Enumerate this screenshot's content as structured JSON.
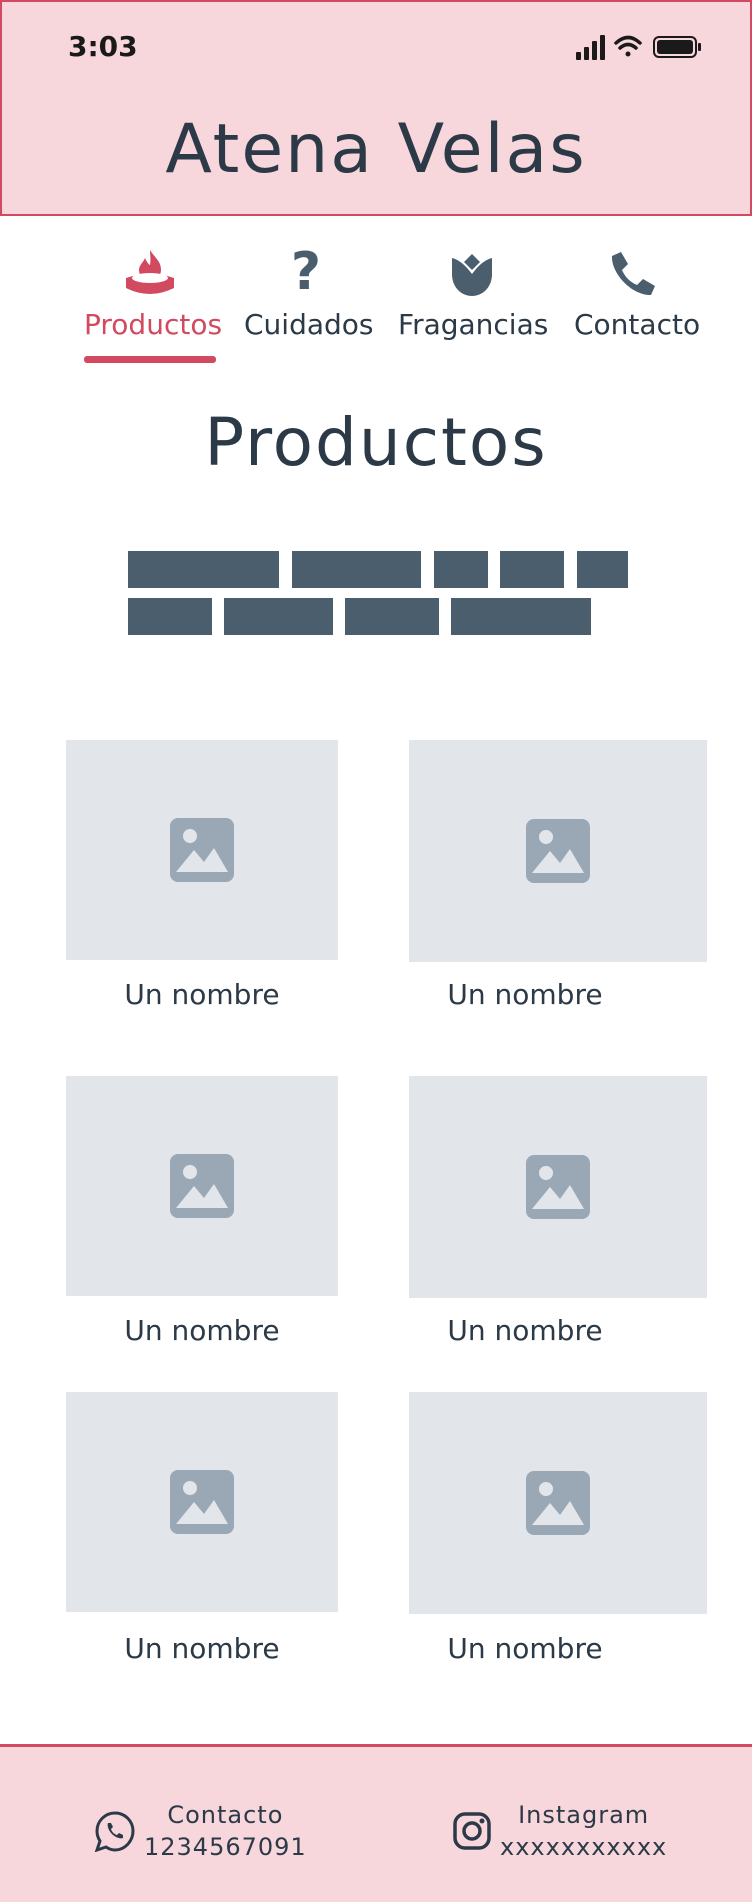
{
  "status_bar": {
    "time": "3:03"
  },
  "header": {
    "title": "Atena Velas"
  },
  "nav": {
    "items": [
      {
        "label": "Productos",
        "icon": "candle-icon",
        "active": true
      },
      {
        "label": "Cuidados",
        "icon": "question-icon",
        "active": false
      },
      {
        "label": "Fragancias",
        "icon": "flower-icon",
        "active": false
      },
      {
        "label": "Contacto",
        "icon": "phone-icon",
        "active": false
      }
    ]
  },
  "main": {
    "title": "Productos",
    "products": [
      {
        "name": "Un nombre"
      },
      {
        "name": "Un nombre"
      },
      {
        "name": "Un nombre"
      },
      {
        "name": "Un nombre"
      },
      {
        "name": "Un nombre"
      },
      {
        "name": "Un nombre"
      }
    ]
  },
  "footer": {
    "contact": {
      "label": "Contacto",
      "value": "1234567091",
      "icon": "whatsapp-icon"
    },
    "instagram": {
      "label": "Instagram",
      "value": "xxxxxxxxxxx",
      "icon": "instagram-icon"
    }
  },
  "colors": {
    "accent": "#d24a60",
    "header_bg": "#f7d6dc",
    "text": "#2c3a48",
    "chip": "#4b5e6e",
    "placeholder_bg": "#e2e6ea"
  }
}
